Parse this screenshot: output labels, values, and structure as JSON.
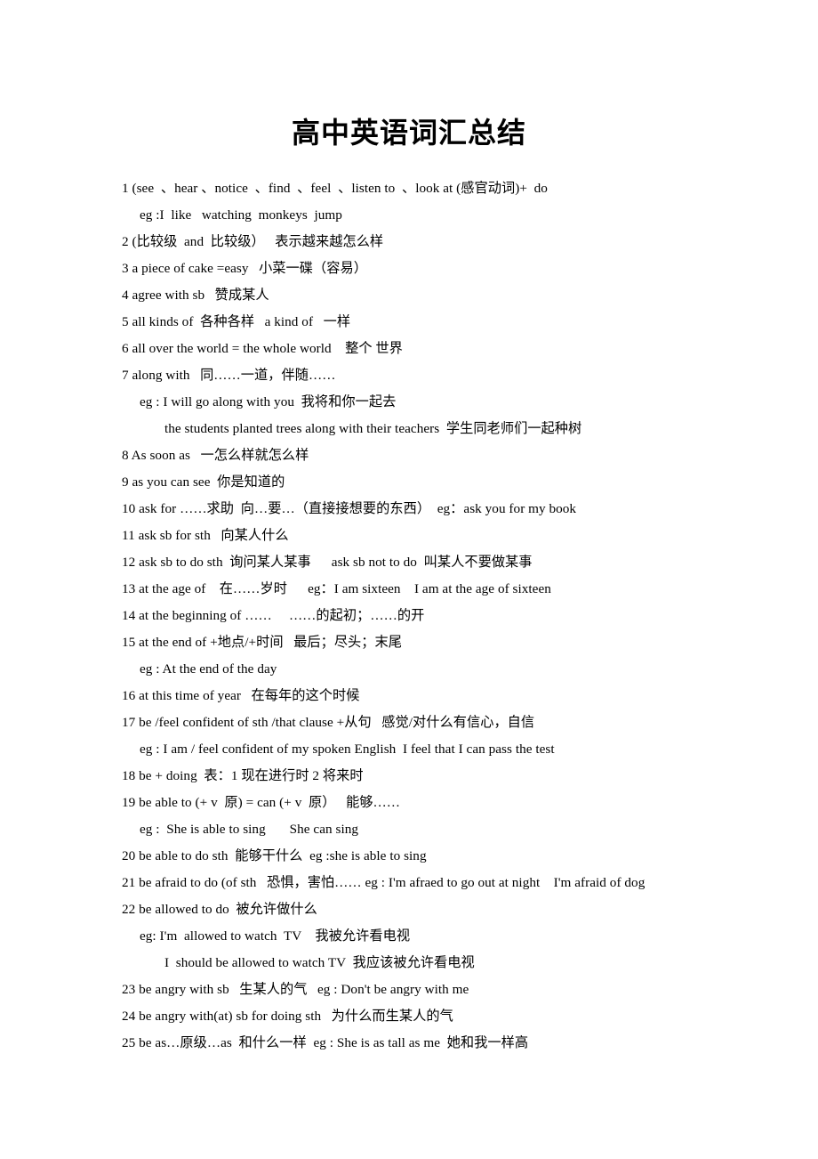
{
  "document": {
    "title": "高中英语词汇总结",
    "lines": [
      {
        "indent": 0,
        "text": "1 (see  、hear 、notice  、find  、feel  、listen to  、look at (感官动词)+  do"
      },
      {
        "indent": 1,
        "text": "eg :I  like   watching  monkeys  jump"
      },
      {
        "indent": 0,
        "text": "2 (比较级  and  比较级）   表示越来越怎么样"
      },
      {
        "indent": 0,
        "text": "3 a piece of cake =easy   小菜一碟（容易）"
      },
      {
        "indent": 0,
        "text": "4 agree with sb   赞成某人"
      },
      {
        "indent": 0,
        "text": "5 all kinds of  各种各样   a kind of   一样"
      },
      {
        "indent": 0,
        "text": "6 all over the world = the whole world    整个 世界"
      },
      {
        "indent": 0,
        "text": "7 along with   同……一道，伴随……"
      },
      {
        "indent": 1,
        "text": "eg : I will go along with you  我将和你一起去"
      },
      {
        "indent": 2,
        "text": "the students planted trees along with their teachers  学生同老师们一起种树"
      },
      {
        "indent": 0,
        "text": "8 As soon as   一怎么样就怎么样"
      },
      {
        "indent": 0,
        "text": "9 as you can see  你是知道的"
      },
      {
        "indent": 0,
        "text": "10 ask for ……求助  向…要…（直接接想要的东西）  eg：ask you for my book"
      },
      {
        "indent": 0,
        "text": "11 ask sb for sth   向某人什么"
      },
      {
        "indent": 0,
        "text": "12 ask sb to do sth  询问某人某事      ask sb not to do  叫某人不要做某事"
      },
      {
        "indent": 0,
        "text": "13 at the age of    在……岁时      eg：I am sixteen    I am at the age of sixteen"
      },
      {
        "indent": 0,
        "text": "14 at the beginning of ……     ……的起初；……的开"
      },
      {
        "indent": 0,
        "text": "15 at the end of +地点/+时间   最后；尽头；末尾"
      },
      {
        "indent": 1,
        "text": "eg : At the end of the day"
      },
      {
        "indent": 0,
        "text": "16 at this time of year   在每年的这个时候"
      },
      {
        "indent": 0,
        "text": "17 be /feel confident of sth /that clause +从句   感觉/对什么有信心，自信"
      },
      {
        "indent": 1,
        "text": "eg : I am / feel confident of my spoken English  I feel that I can pass the test"
      },
      {
        "indent": 0,
        "text": "18 be + doing  表：1 现在进行时 2 将来时"
      },
      {
        "indent": 0,
        "text": "19 be able to (+ v  原) = can (+ v  原）   能够……"
      },
      {
        "indent": 1,
        "text": "eg :  She is able to sing       She can sing"
      },
      {
        "indent": 0,
        "text": "20 be able to do sth  能够干什么  eg :she is able to sing"
      },
      {
        "indent": 0,
        "text": "21 be afraid to do (of sth   恐惧，害怕…… eg : I'm afraed to go out at night    I'm afraid of dog"
      },
      {
        "indent": 0,
        "text": "22 be allowed to do  被允许做什么"
      },
      {
        "indent": 1,
        "text": "eg: I'm  allowed to watch  TV    我被允许看电视"
      },
      {
        "indent": 2,
        "text": "I  should be allowed to watch TV  我应该被允许看电视"
      },
      {
        "indent": 0,
        "text": "23 be angry with sb   生某人的气   eg : Don't be angry with me"
      },
      {
        "indent": 0,
        "text": "24 be angry with(at) sb for doing sth   为什么而生某人的气"
      },
      {
        "indent": 0,
        "text": "25 be as…原级…as  和什么一样  eg : She is as tall as me  她和我一样高"
      }
    ]
  }
}
